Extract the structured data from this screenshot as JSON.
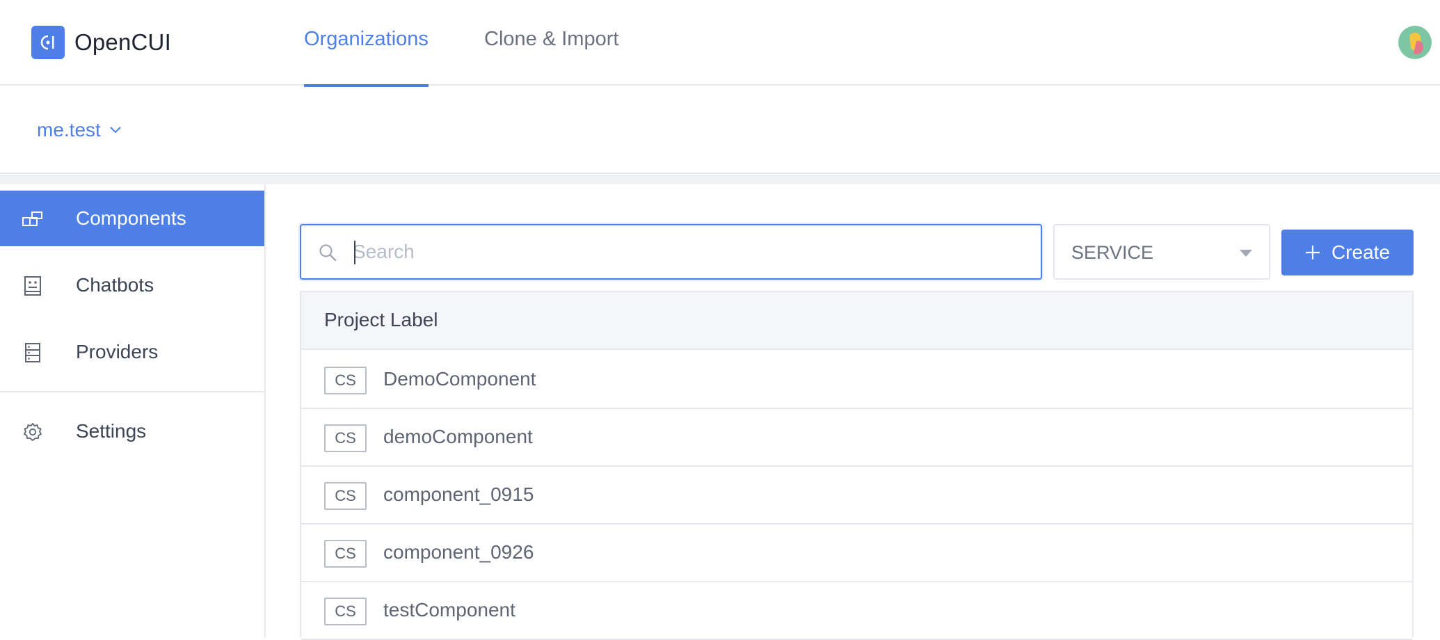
{
  "app": {
    "name": "OpenCUI"
  },
  "topnav": {
    "tabs": [
      {
        "label": "Organizations",
        "active": true
      },
      {
        "label": "Clone & Import",
        "active": false
      }
    ]
  },
  "org": {
    "current": "me.test"
  },
  "sidebar": {
    "items": [
      {
        "label": "Components",
        "icon": "components-icon",
        "active": true
      },
      {
        "label": "Chatbots",
        "icon": "chatbot-icon",
        "active": false
      },
      {
        "label": "Providers",
        "icon": "providers-icon",
        "active": false
      },
      {
        "label": "Settings",
        "icon": "gear-icon",
        "active": false
      }
    ]
  },
  "search": {
    "placeholder": "Search",
    "value": ""
  },
  "filter": {
    "selected": "SERVICE"
  },
  "actions": {
    "create_label": "Create"
  },
  "table": {
    "header": "Project Label",
    "rows": [
      {
        "tag": "CS",
        "name": "DemoComponent"
      },
      {
        "tag": "CS",
        "name": "demoComponent"
      },
      {
        "tag": "CS",
        "name": "component_0915"
      },
      {
        "tag": "CS",
        "name": "component_0926"
      },
      {
        "tag": "CS",
        "name": "testComponent"
      }
    ]
  },
  "colors": {
    "accent": "#4d7fe6",
    "text": "#3d4455",
    "border": "#e6e8ed"
  }
}
